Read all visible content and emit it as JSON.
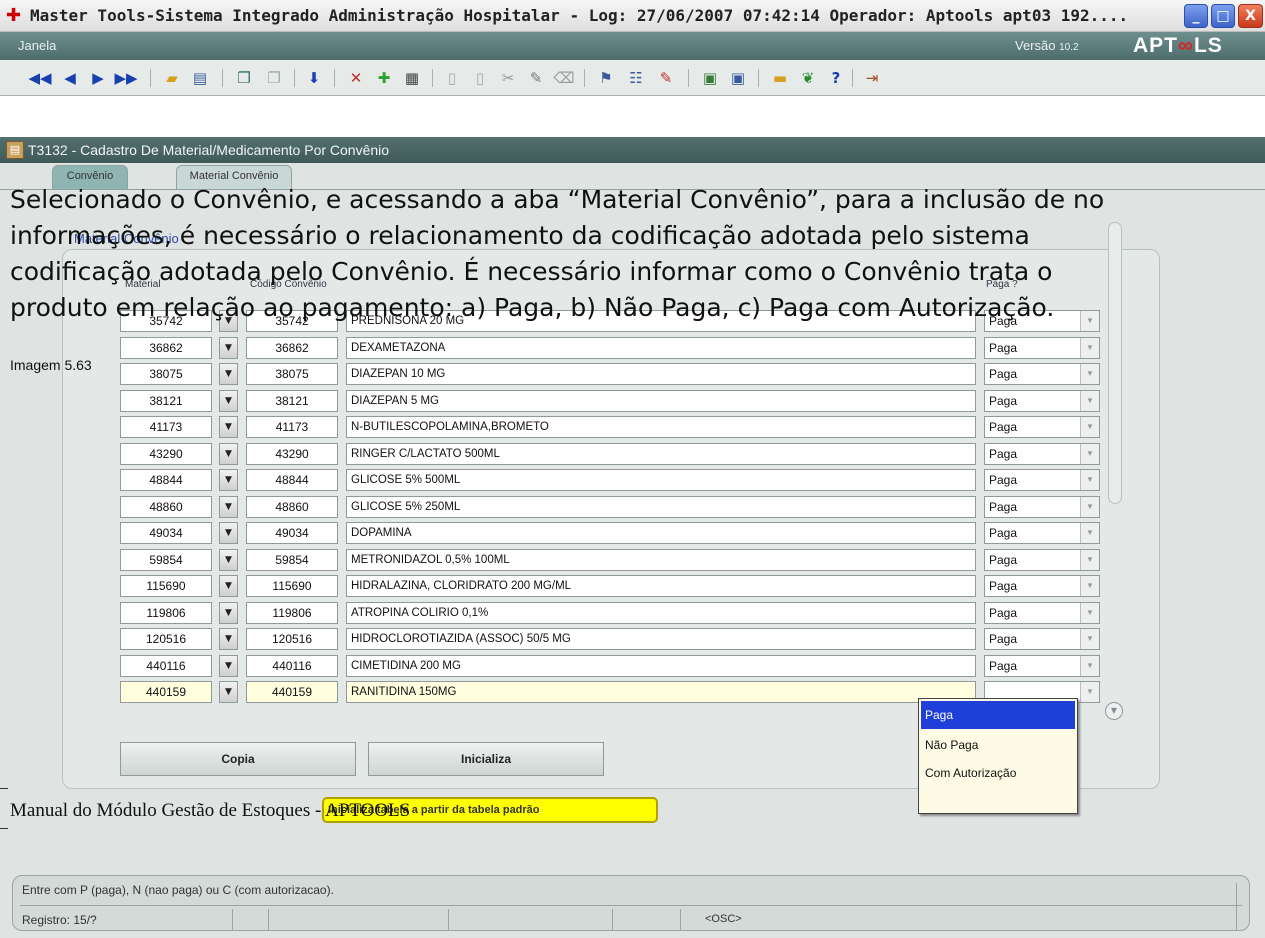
{
  "window": {
    "title": "Master Tools-Sistema Integrado Administração Hospitalar - Log: 27/06/2007 07:42:14 Operador: Aptools apt03 192....",
    "minimize": "_",
    "maximize": "□",
    "close": "X"
  },
  "menubar": {
    "menu_label": "Janela",
    "version_label": "Versão",
    "version_number": "10.2",
    "logo_before": "APT",
    "logo_mark": "∞",
    "logo_after": "LS"
  },
  "toolbar": {
    "icons": [
      "first-record-icon",
      "previous-record-icon",
      "next-record-icon",
      "last-record-icon",
      "open-icon",
      "print-icon",
      "copy-icon",
      "paste-icon",
      "save-icon",
      "delete-record-icon",
      "insert-record-icon",
      "grid-icon",
      "new-page-icon",
      "duplicate-icon",
      "cut-icon",
      "edit-icon",
      "clear-icon",
      "query-icon",
      "execute-query-icon",
      "cancel-query-icon",
      "window-icon",
      "list-icon",
      "keyboard-icon",
      "help-wizard-icon",
      "help-icon",
      "exit-icon"
    ]
  },
  "form": {
    "title": "T3132 - Cadastro De Material/Medicamento Por Convênio",
    "tab_convenio": "Convênio",
    "tab_material": "Material Convênio",
    "table_heading": "Material Convênio",
    "col_material": "Material",
    "col_codigo": "Código Convênio",
    "col_paga": "Paga ?"
  },
  "rows": [
    {
      "code": "35742",
      "conv_code": "35742",
      "name": "PREDNISONA 20 MG",
      "paga": "Paga"
    },
    {
      "code": "36862",
      "conv_code": "36862",
      "name": "DEXAMETAZONA",
      "paga": "Paga"
    },
    {
      "code": "38075",
      "conv_code": "38075",
      "name": "DIAZEPAN 10 MG",
      "paga": "Paga"
    },
    {
      "code": "38121",
      "conv_code": "38121",
      "name": "DIAZEPAN 5 MG",
      "paga": "Paga"
    },
    {
      "code": "41173",
      "conv_code": "41173",
      "name": "N-BUTILESCOPOLAMINA,BROMETO",
      "paga": "Paga"
    },
    {
      "code": "43290",
      "conv_code": "43290",
      "name": "RINGER C/LACTATO 500ML",
      "paga": "Paga"
    },
    {
      "code": "48844",
      "conv_code": "48844",
      "name": "GLICOSE 5% 500ML",
      "paga": "Paga"
    },
    {
      "code": "48860",
      "conv_code": "48860",
      "name": "GLICOSE 5% 250ML",
      "paga": "Paga"
    },
    {
      "code": "49034",
      "conv_code": "49034",
      "name": "DOPAMINA",
      "paga": "Paga"
    },
    {
      "code": "59854",
      "conv_code": "59854",
      "name": "METRONIDAZOL 0,5% 100ML",
      "paga": "Paga"
    },
    {
      "code": "115690",
      "conv_code": "115690",
      "name": "HIDRALAZINA, CLORIDRATO 200 MG/ML",
      "paga": "Paga"
    },
    {
      "code": "119806",
      "conv_code": "119806",
      "name": "ATROPINA COLIRIO 0,1%",
      "paga": "Paga"
    },
    {
      "code": "120516",
      "conv_code": "120516",
      "name": "HIDROCLOROTIAZIDA (ASSOC) 50/5 MG",
      "paga": "Paga"
    },
    {
      "code": "440116",
      "conv_code": "440116",
      "name": "CIMETIDINA 200 MG",
      "paga": "Paga"
    },
    {
      "code": "440159",
      "conv_code": "440159",
      "name": "RANITIDINA 150MG",
      "paga": ""
    }
  ],
  "buttons": {
    "copia": "Copia",
    "inicializa": "Inicializa"
  },
  "dropdown": {
    "options": [
      "Paga",
      "Não Paga",
      "Com Autorização"
    ]
  },
  "tooltip": "Inicializa tabela a partir da tabela padrão",
  "status": {
    "message": "Entre com P (paga), N (nao paga) ou C (com autorizacao).",
    "record": "Registro: 15/?",
    "osc": "<OSC>"
  },
  "document": {
    "paragraph_lines": [
      "Selecionado o Convênio, e acessando a aba “Material Convênio”, para a inclusão de no",
      "informações, é necessário o relacionamento da codificação adotada pelo sistema",
      "codificação adotada pelo Convênio. É necessário informar como o Convênio trata o",
      "produto em relação ao pagamento: a) Paga, b) Não Paga, c) Paga com Autorização."
    ],
    "caption": "Imagem 5.63",
    "footer": "Manual do Módulo Gestão de Estoques - APTOOLS"
  }
}
